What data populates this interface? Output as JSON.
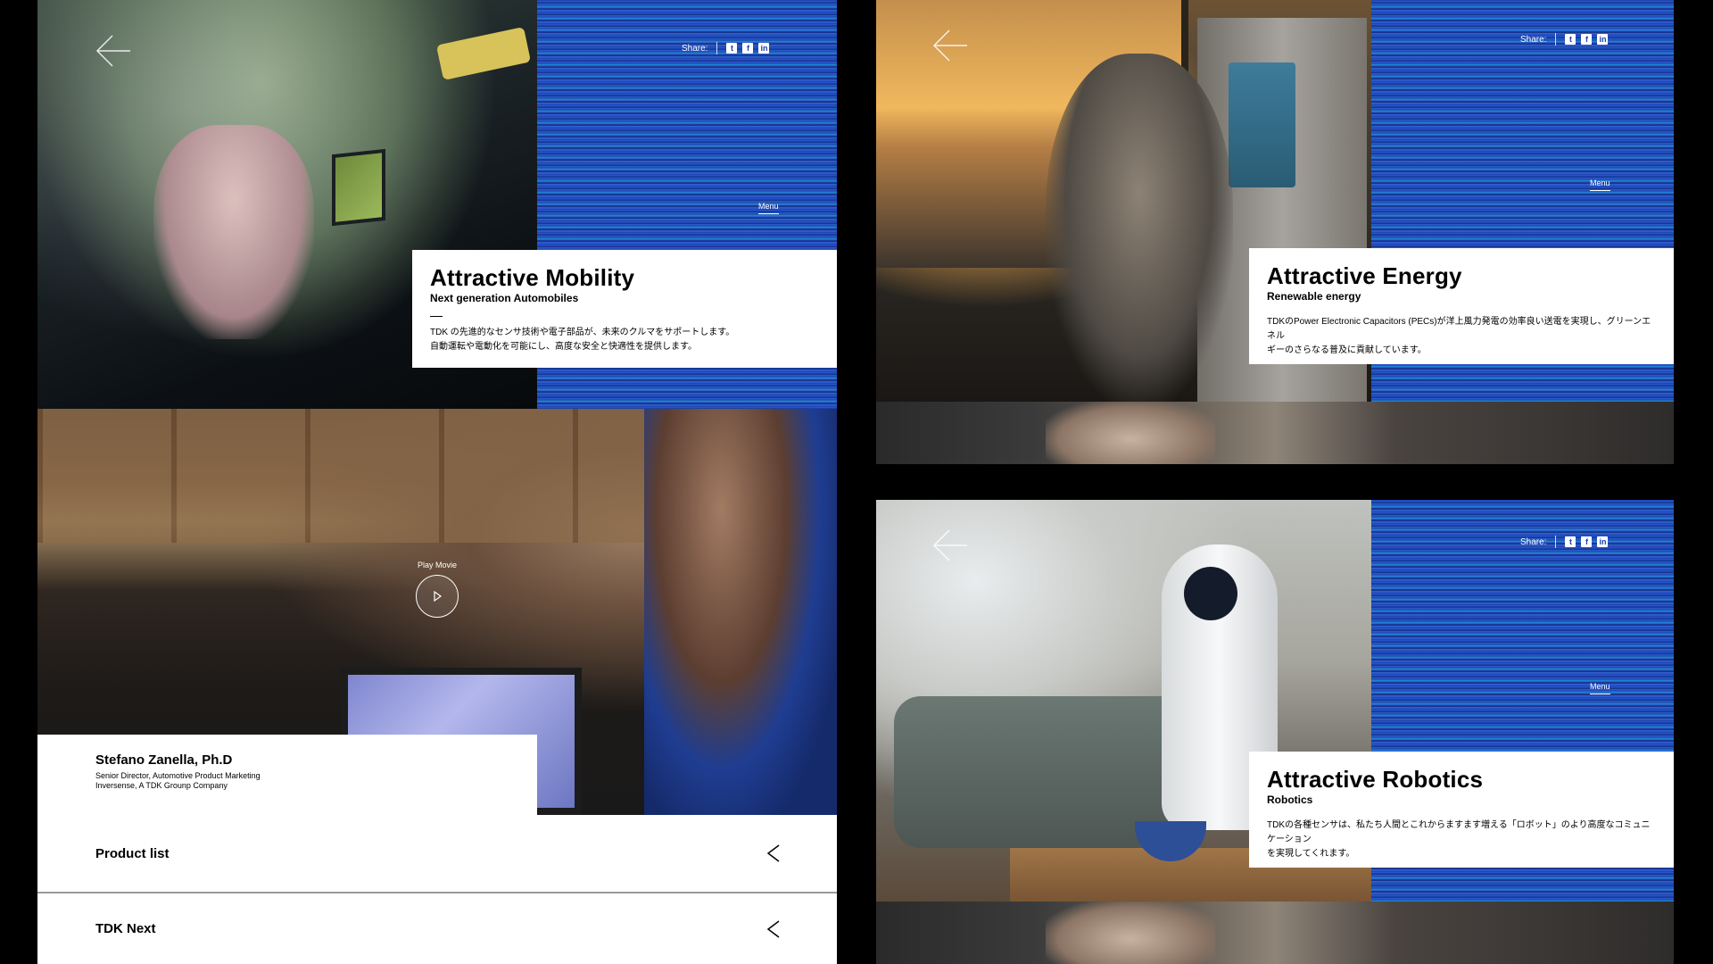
{
  "mobility": {
    "share_label": "Share:",
    "menu_label": "Menu",
    "title": "Attractive Mobility",
    "subtitle": "Next generation Automobiles",
    "body_line1": "TDK の先進的なセンサ技術や電子部品が、未来のクルマをサポートします。",
    "body_line2": "自動運転や電動化を可能にし、高度な安全と快適性を提供します。"
  },
  "video": {
    "play_label": "Play Movie",
    "speaker_name": "Stefano Zanella, Ph.D",
    "speaker_role1": "Senior Director, Automotive Product Marketing",
    "speaker_role2": "Inversense, A TDK Grounp Company"
  },
  "list": {
    "items": [
      {
        "label": "Product list"
      },
      {
        "label": "TDK Next"
      }
    ]
  },
  "energy": {
    "share_label": "Share:",
    "menu_label": "Menu",
    "title": "Attractive Energy",
    "subtitle": "Renewable energy",
    "body_line1": "TDKのPower Electronic Capacitors (PECs)が洋上風力発電の効率良い送電を実現し、グリーンエネル",
    "body_line2": "ギーのさらなる普及に貢献しています。"
  },
  "robotics": {
    "share_label": "Share:",
    "menu_label": "Menu",
    "title": "Attractive Robotics",
    "subtitle": "Robotics",
    "body_line1": "TDKの各種センサは、私たち人間とこれからますます増える「ロボット」のより高度なコミュニケーション",
    "body_line2": "を実現してくれます。"
  },
  "icons": {
    "back": "arrow-left-icon",
    "twitter": "twitter-icon",
    "facebook": "facebook-icon",
    "linkedin": "linkedin-icon",
    "play": "play-icon",
    "chevron": "chevron-left-icon"
  },
  "colors": {
    "stripe_blue": "#2a5ad8",
    "card_bg": "#ffffff",
    "text": "#000000",
    "page_bg": "#000000"
  }
}
